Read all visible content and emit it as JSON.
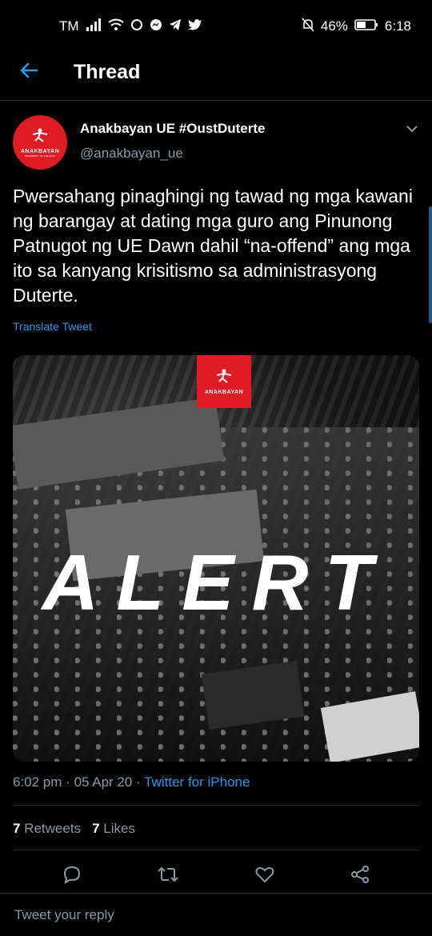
{
  "status_bar": {
    "carrier": "TM",
    "battery": "46%",
    "time": "6:18"
  },
  "header": {
    "title": "Thread"
  },
  "tweet": {
    "author_name": "Anakbayan UE #OustDuterte",
    "author_handle": "@anakbayan_ue",
    "avatar_text": "ANAKBAYAN",
    "avatar_subtext": "UNIVERSITY OF THE EAST",
    "text": "Pwersahang pinaghingi ng tawad ng mga kawani ng barangay at dating mga guro ang Pinunong Patnugot ng UE Dawn dahil “na-offend” ang mga ito sa kanyang krisitismo sa administrasyong Duterte.",
    "translate_label": "Translate Tweet",
    "media_alert_text": "ALERT",
    "media_logo_text": "ANAKBAYAN",
    "time": "6:02 pm",
    "date": "05 Apr 20",
    "source": "Twitter for iPhone",
    "retweets_count": "7",
    "retweets_label": "Retweets",
    "likes_count": "7",
    "likes_label": "Likes"
  },
  "reply": {
    "placeholder": "Tweet your reply"
  },
  "colors": {
    "accent": "#1d9bf0",
    "brand_red": "#e01b24",
    "secondary_text": "#8b98a5"
  },
  "icons": [
    "back-arrow-icon",
    "chevron-down-icon",
    "reply-icon",
    "retweet-icon",
    "like-icon",
    "share-icon"
  ]
}
